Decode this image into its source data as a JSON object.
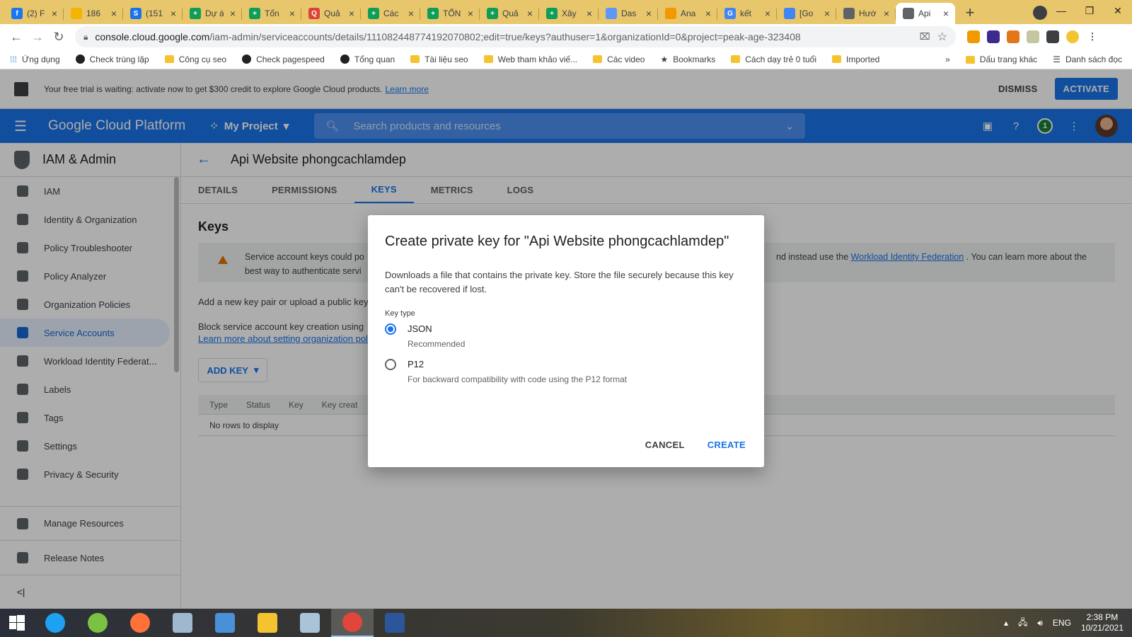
{
  "browser": {
    "tabs": [
      {
        "title": "(2) F",
        "color": "#1877f2",
        "glyph": "f"
      },
      {
        "title": "186",
        "color": "#f4b400",
        "glyph": ""
      },
      {
        "title": "(151",
        "color": "#1a73e8",
        "glyph": "S"
      },
      {
        "title": "Dự á",
        "color": "#0f9d58",
        "glyph": "+"
      },
      {
        "title": "Tổn",
        "color": "#0f9d58",
        "glyph": "+"
      },
      {
        "title": "Quả",
        "color": "#db4437",
        "glyph": "Q"
      },
      {
        "title": "Các",
        "color": "#0f9d58",
        "glyph": "+"
      },
      {
        "title": "TỔN",
        "color": "#0f9d58",
        "glyph": "+"
      },
      {
        "title": "Quả",
        "color": "#0f9d58",
        "glyph": "+"
      },
      {
        "title": "Xây",
        "color": "#0f9d58",
        "glyph": "+"
      },
      {
        "title": "Das",
        "color": "#5e97f6",
        "glyph": ""
      },
      {
        "title": "Ana",
        "color": "#f29900",
        "glyph": ""
      },
      {
        "title": "kết",
        "color": "#4285f4",
        "glyph": "G"
      },
      {
        "title": "[Go",
        "color": "#4285f4",
        "glyph": ""
      },
      {
        "title": "Hướ",
        "color": "#5f6368",
        "glyph": ""
      },
      {
        "title": "Api",
        "color": "#5f6368",
        "glyph": "",
        "active": true
      }
    ],
    "url_host": "console.cloud.google.com",
    "url_rest": "/iam-admin/serviceaccounts/details/111082448774192070802;edit=true/keys?authuser=1&organizationId=0&project=peak-age-323408",
    "bookmarks": [
      {
        "label": "Ứng dụng",
        "kind": "apps"
      },
      {
        "label": "Check trùng lặp",
        "kind": "globe"
      },
      {
        "label": "Công cụ seo",
        "kind": "folder"
      },
      {
        "label": "Check pagespeed",
        "kind": "globe"
      },
      {
        "label": "Tổng quan",
        "kind": "globe"
      },
      {
        "label": "Tài liệu seo",
        "kind": "folder"
      },
      {
        "label": "Web tham khảo viế...",
        "kind": "folder"
      },
      {
        "label": "Các video",
        "kind": "folder"
      },
      {
        "label": "Bookmarks",
        "kind": "star"
      },
      {
        "label": "Cách dạy trẻ 0 tuổi",
        "kind": "folder"
      },
      {
        "label": "Imported",
        "kind": "folder"
      }
    ],
    "bookmarks_more": "»",
    "bookmarks_other": "Dấu trang khác",
    "reading_list": "Danh sách đọc"
  },
  "trial": {
    "text": "Your free trial is waiting: activate now to get $300 credit to explore Google Cloud products.",
    "link": "Learn more",
    "dismiss": "DISMISS",
    "activate": "ACTIVATE"
  },
  "gcp": {
    "brand": "Google Cloud Platform",
    "project": "My Project",
    "search_placeholder": "Search products and resources",
    "notification_count": "1"
  },
  "sidebar": {
    "title": "IAM & Admin",
    "items": [
      {
        "label": "IAM",
        "icon": "person-add-icon"
      },
      {
        "label": "Identity & Organization",
        "icon": "account-circle-icon"
      },
      {
        "label": "Policy Troubleshooter",
        "icon": "wrench-icon"
      },
      {
        "label": "Policy Analyzer",
        "icon": "document-search-icon"
      },
      {
        "label": "Organization Policies",
        "icon": "list-doc-icon"
      },
      {
        "label": "Service Accounts",
        "icon": "service-account-icon",
        "selected": true
      },
      {
        "label": "Workload Identity Federat...",
        "icon": "id-card-icon"
      },
      {
        "label": "Labels",
        "icon": "label-icon"
      },
      {
        "label": "Tags",
        "icon": "tag-icon"
      },
      {
        "label": "Settings",
        "icon": "gear-icon"
      },
      {
        "label": "Privacy & Security",
        "icon": "shield-icon"
      }
    ],
    "bottom": [
      {
        "label": "Manage Resources",
        "icon": "manage-resources-icon"
      },
      {
        "label": "Release Notes",
        "icon": "release-notes-icon"
      }
    ],
    "collapse": "<|"
  },
  "main": {
    "title": "Api Website phongcachlamdep",
    "tabs": [
      "DETAILS",
      "PERMISSIONS",
      "KEYS",
      "METRICS",
      "LOGS"
    ],
    "selected_tab": "KEYS",
    "section_title": "Keys",
    "warning_start": "Service account keys could po",
    "warning_right": "nd instead use the",
    "warning_link": "Workload Identity Federation",
    "warning_end": ". You can learn more about the",
    "warning_line2": "best way to authenticate servi",
    "add_line": "Add a new key pair or upload a public key",
    "block_line": "Block service account key creation using",
    "learn_more": "Learn more about setting organization pol",
    "add_key": "ADD KEY",
    "table_headers": [
      "Type",
      "Status",
      "Key",
      "Key creat"
    ],
    "empty": "No rows to display"
  },
  "dialog": {
    "title": "Create private key for \"Api Website phongcachlamdep\"",
    "description": "Downloads a file that contains the private key. Store the file securely because this key can't be recovered if lost.",
    "key_type_label": "Key type",
    "options": [
      {
        "label": "JSON",
        "sub": "Recommended",
        "selected": true
      },
      {
        "label": "P12",
        "sub": "For backward compatibility with code using the P12 format",
        "selected": false
      }
    ],
    "cancel": "CANCEL",
    "create": "CREATE"
  },
  "taskbar": {
    "apps": [
      "internet-explorer",
      "greenshot",
      "firefox",
      "calculator",
      "control-panel",
      "file-explorer",
      "notepad",
      "chrome",
      "word"
    ],
    "active_app": "chrome",
    "language": "ENG",
    "time": "2:38 PM",
    "date": "10/21/2021"
  }
}
